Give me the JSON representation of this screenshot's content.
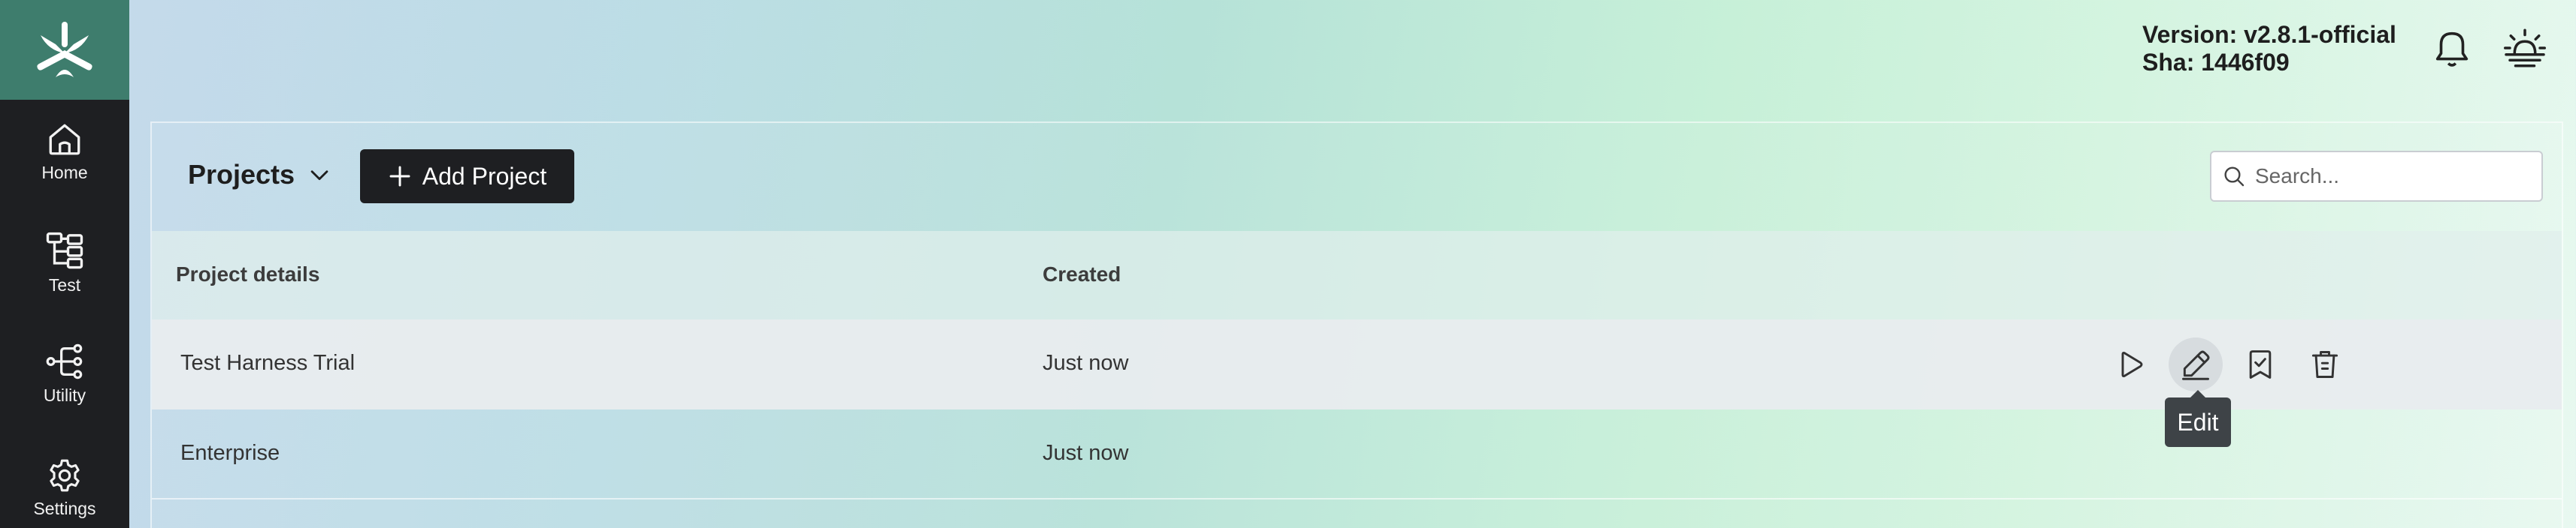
{
  "sidebar": {
    "items": [
      {
        "label": "Home",
        "icon": "home-icon"
      },
      {
        "label": "Test",
        "icon": "test-tree-icon"
      },
      {
        "label": "Utility",
        "icon": "utility-branch-icon"
      },
      {
        "label": "Settings",
        "icon": "gear-icon"
      }
    ]
  },
  "header": {
    "version": "Version: v2.8.1-official",
    "sha": "Sha: 1446f09"
  },
  "toolbar": {
    "projects_label": "Projects",
    "add_project_label": "Add Project",
    "search_placeholder": "Search..."
  },
  "table": {
    "columns": [
      "Project details",
      "Created"
    ],
    "rows": [
      {
        "name": "Test Harness Trial",
        "created": "Just now"
      },
      {
        "name": "Enterprise",
        "created": "Just now"
      }
    ]
  },
  "tooltip": {
    "text": "Edit"
  },
  "colors": {
    "sidebar_bg": "#1e1f22",
    "logo_bg": "#3e7d6d",
    "button_bg": "#1e1f22"
  }
}
